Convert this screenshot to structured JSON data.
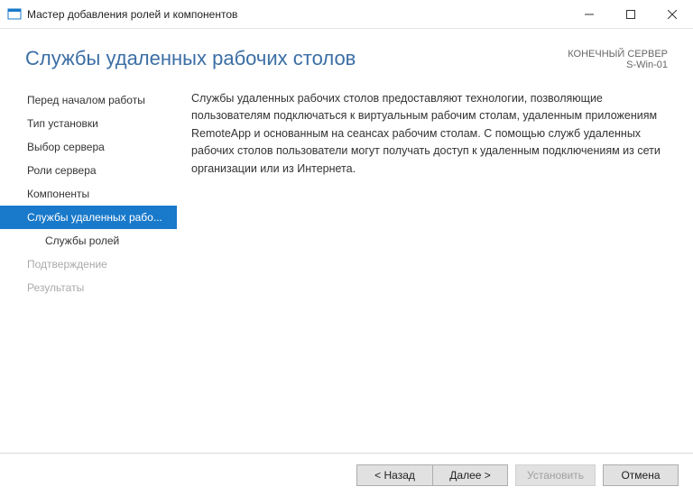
{
  "window": {
    "title": "Мастер добавления ролей и компонентов"
  },
  "header": {
    "page_title": "Службы удаленных рабочих столов",
    "destination_label": "КОНЕЧНЫЙ СЕРВЕР",
    "destination_server": "S-Win-01"
  },
  "sidebar": {
    "items": [
      {
        "label": "Перед началом работы",
        "selected": false,
        "disabled": false,
        "sub": false
      },
      {
        "label": "Тип установки",
        "selected": false,
        "disabled": false,
        "sub": false
      },
      {
        "label": "Выбор сервера",
        "selected": false,
        "disabled": false,
        "sub": false
      },
      {
        "label": "Роли сервера",
        "selected": false,
        "disabled": false,
        "sub": false
      },
      {
        "label": "Компоненты",
        "selected": false,
        "disabled": false,
        "sub": false
      },
      {
        "label": "Службы удаленных рабо...",
        "selected": true,
        "disabled": false,
        "sub": false
      },
      {
        "label": "Службы ролей",
        "selected": false,
        "disabled": false,
        "sub": true
      },
      {
        "label": "Подтверждение",
        "selected": false,
        "disabled": true,
        "sub": false
      },
      {
        "label": "Результаты",
        "selected": false,
        "disabled": true,
        "sub": false
      }
    ]
  },
  "content": {
    "description": "Службы удаленных рабочих столов предоставляют технологии, позволяющие пользователям подключаться к виртуальным рабочим столам, удаленным приложениям RemoteApp и основанным на сеансах рабочим столам. С помощью служб удаленных рабочих столов пользователи могут получать доступ к удаленным подключениям из сети организации или из Интернета."
  },
  "footer": {
    "back": "< Назад",
    "next": "Далее >",
    "install": "Установить",
    "cancel": "Отмена"
  }
}
